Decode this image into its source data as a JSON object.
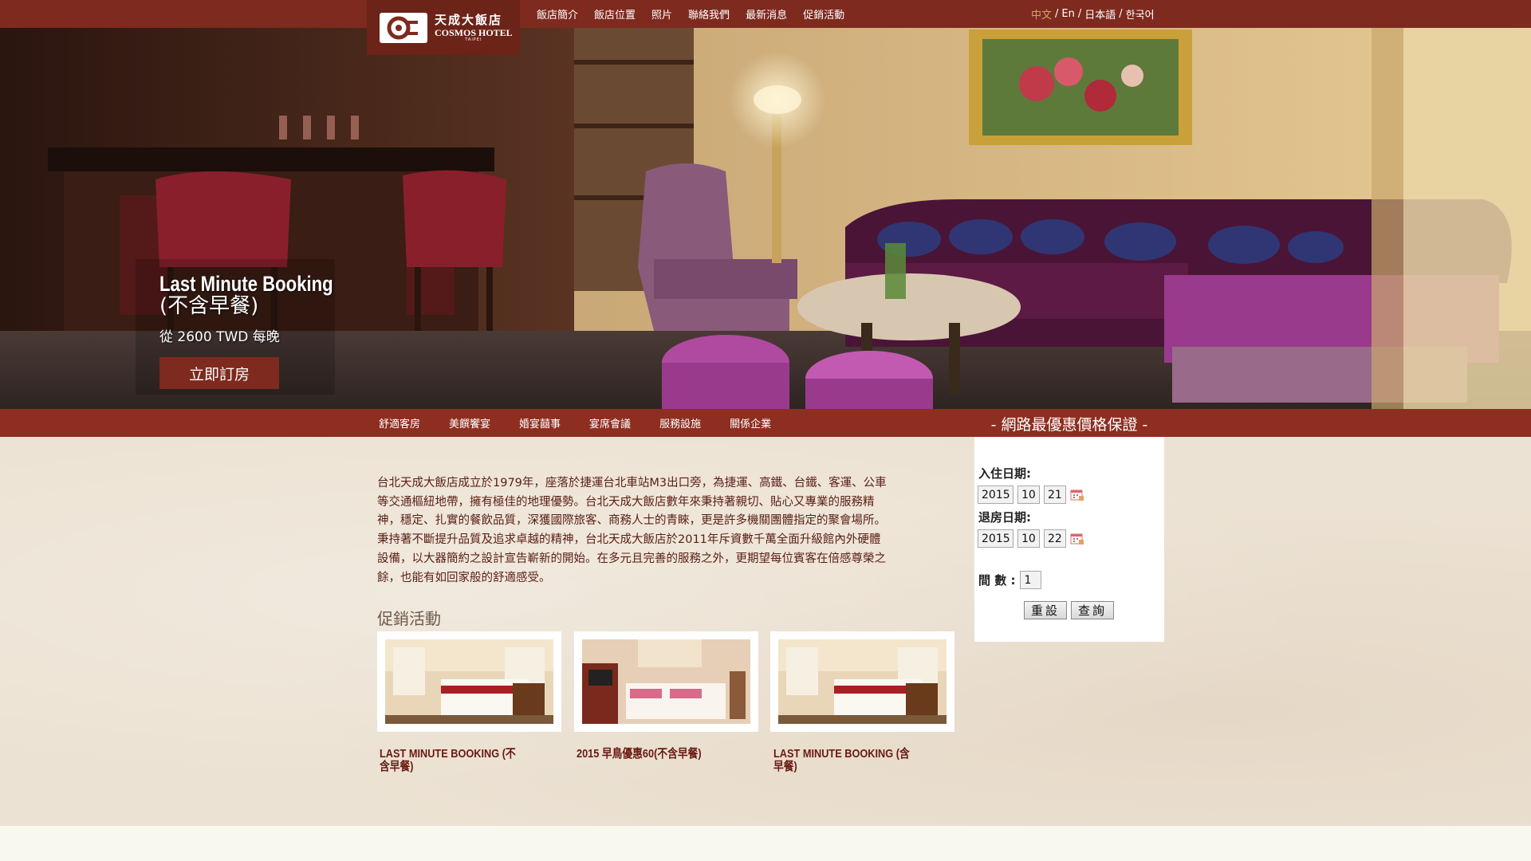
{
  "logo": {
    "name_cn": "天成大飯店",
    "name_en": "COSMOS HOTEL",
    "city": "TAIPEI"
  },
  "top_nav": [
    "飯店簡介",
    "飯店位置",
    "照片",
    "聯絡我們",
    "最新消息",
    "促銷活動"
  ],
  "languages": [
    {
      "label": "中文",
      "active": true
    },
    {
      "label": "En",
      "active": false
    },
    {
      "label": "日本語",
      "active": false
    },
    {
      "label": "한국어",
      "active": false
    }
  ],
  "language_separator": "/",
  "hero": {
    "title": "Last Minute Booking",
    "subtitle": "(不含早餐)",
    "price": "從 2600 TWD 每晚",
    "button": "立即訂房"
  },
  "main_nav": [
    "舒適客房",
    "美饌饗宴",
    "婚宴囍事",
    "宴席會議",
    "服務設施",
    "關係企業"
  ],
  "intro": "台北天成大飯店成立於1979年，座落於捷運台北車站M3出口旁，為捷運、高鐵、台鐵、客運、公車等交通樞紐地帶，擁有極佳的地理優勢。台北天成大飯店數年來秉持著親切、貼心又專業的服務精神，穩定、扎實的餐飲品質，深獲國際旅客、商務人士的青睞，更是許多機關團體指定的聚會場所。秉持著不斷提升品質及追求卓越的精神，台北天成大飯店於2011年斥資數千萬全面升級館內外硬體設備，以大器簡約之設計宣告嶄新的開始。在多元且完善的服務之外，更期望每位賓客在倍感尊榮之餘，也能有如回家般的舒適感受。",
  "promotions_title": "促銷活動",
  "promotions": [
    {
      "caption": "LAST MINUTE BOOKING (不含早餐)"
    },
    {
      "caption": "2015 早鳥優惠60(不含早餐)"
    },
    {
      "caption": "LAST MINUTE BOOKING (含早餐)"
    }
  ],
  "booking": {
    "title": "- 網路最優惠價格保證 -",
    "checkin_label": "入住日期:",
    "checkin": {
      "year": "2015",
      "month": "10",
      "day": "21"
    },
    "checkout_label": "退房日期:",
    "checkout": {
      "year": "2015",
      "month": "10",
      "day": "22"
    },
    "rooms_label": "間 數 :",
    "rooms": "1",
    "reset": "重設",
    "search": "查詢"
  },
  "colors": {
    "brand_red": "#7e2a1e",
    "nav_red": "#8d2e20",
    "content_bg": "#ece2d3",
    "active_lang": "#d5a373"
  }
}
